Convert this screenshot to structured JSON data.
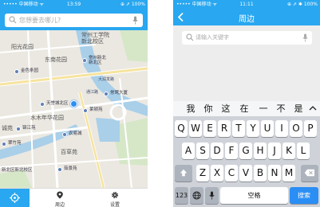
{
  "left_phone": {
    "status_bar": {
      "carrier": "••••• 中国移动 ᯤ",
      "time": "13:59",
      "right": "⊕ ⇗ 100%"
    },
    "search": {
      "placeholder": "您想要去哪儿?"
    },
    "map": {
      "labels": {
        "school": "常州工学院\n新北校区",
        "yangguang": "阳光花园",
        "dongnan": "东南花园",
        "changzhou_new_area": "常州新北\n新北区",
        "jinse": "金色条园",
        "dayang": "大润发路",
        "tongjiang": "通江路",
        "changying": "常莺大厦",
        "tianwei": "天誉城北区",
        "shuimu": "水木年华花园",
        "laidun": "莱顿苑",
        "jinjiang": "锦江苑",
        "nongyi": "农易城",
        "baicao": "百草苑",
        "cheng": "诚苑",
        "xinbei": "新北区新北校区",
        "cui": "翠竹苑",
        "xixin": "茹景苑"
      }
    },
    "bottom_nav": {
      "nearby": "周边",
      "settings": "设置"
    }
  },
  "right_phone": {
    "status_bar": {
      "carrier": "••••• 中国移动 ᯤ",
      "time": "11:11",
      "right": "⊕ ⇗ ✱ 100%"
    },
    "header": {
      "title": "周边"
    },
    "search": {
      "placeholder": "请输入关键字"
    },
    "candidates": [
      "我",
      "你",
      "这",
      "在",
      "一",
      "不",
      "是"
    ],
    "keyboard": {
      "row1": [
        "Q",
        "W",
        "E",
        "R",
        "T",
        "Y",
        "U",
        "I",
        "O",
        "P"
      ],
      "row2": [
        "A",
        "S",
        "D",
        "F",
        "G",
        "H",
        "J",
        "K",
        "L"
      ],
      "row3": [
        "Z",
        "X",
        "C",
        "V",
        "B",
        "N",
        "M"
      ],
      "num_key": "123",
      "space_key": "空格",
      "search_key": "搜索"
    }
  },
  "colors": {
    "accent": "#29a7f0",
    "search_key": "#2a8ef5"
  }
}
